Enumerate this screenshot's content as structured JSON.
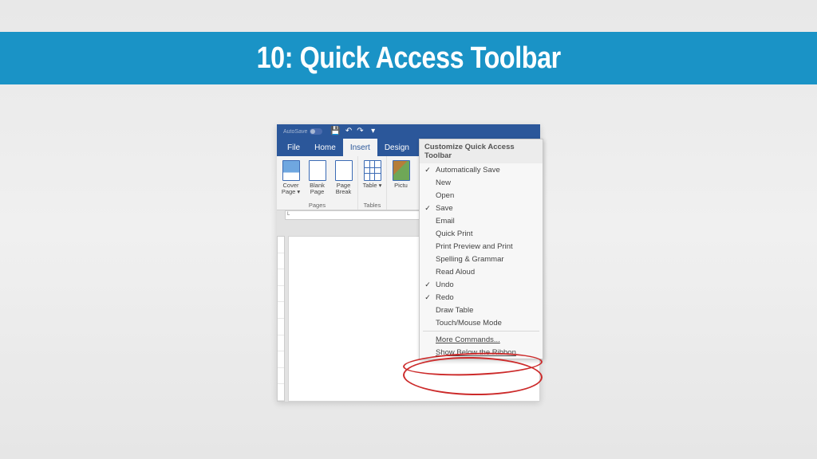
{
  "banner": {
    "title": "10: Quick Access Toolbar"
  },
  "qat": {
    "autosave_label": "AutoSave",
    "icons": {
      "save": "💾",
      "undo": "↶",
      "redo": "↷",
      "dropdown": "▾"
    }
  },
  "tabs": {
    "file": "File",
    "home": "Home",
    "insert": "Insert",
    "design": "Design"
  },
  "ribbon": {
    "pages": {
      "cover": "Cover Page ▾",
      "blank": "Blank Page",
      "break": "Page Break",
      "group_label": "Pages"
    },
    "tables": {
      "table": "Table ▾",
      "group_label": "Tables"
    },
    "illustrations": {
      "pictures": "Pictu"
    }
  },
  "ruler": {
    "tab": "L"
  },
  "dropdown": {
    "header": "Customize Quick Access Toolbar",
    "items": [
      {
        "checked": true,
        "label": "Automatically Save"
      },
      {
        "checked": false,
        "label": "New"
      },
      {
        "checked": false,
        "label": "Open"
      },
      {
        "checked": true,
        "label": "Save"
      },
      {
        "checked": false,
        "label": "Email"
      },
      {
        "checked": false,
        "label": "Quick Print"
      },
      {
        "checked": false,
        "label": "Print Preview and Print"
      },
      {
        "checked": false,
        "label": "Spelling & Grammar"
      },
      {
        "checked": false,
        "label": "Read Aloud"
      },
      {
        "checked": true,
        "label": "Undo"
      },
      {
        "checked": true,
        "label": "Redo"
      },
      {
        "checked": false,
        "label": "Draw Table"
      },
      {
        "checked": false,
        "label": "Touch/Mouse Mode"
      }
    ],
    "more_commands": "More Commands...",
    "show_below": "Show Below the Ribbon"
  }
}
